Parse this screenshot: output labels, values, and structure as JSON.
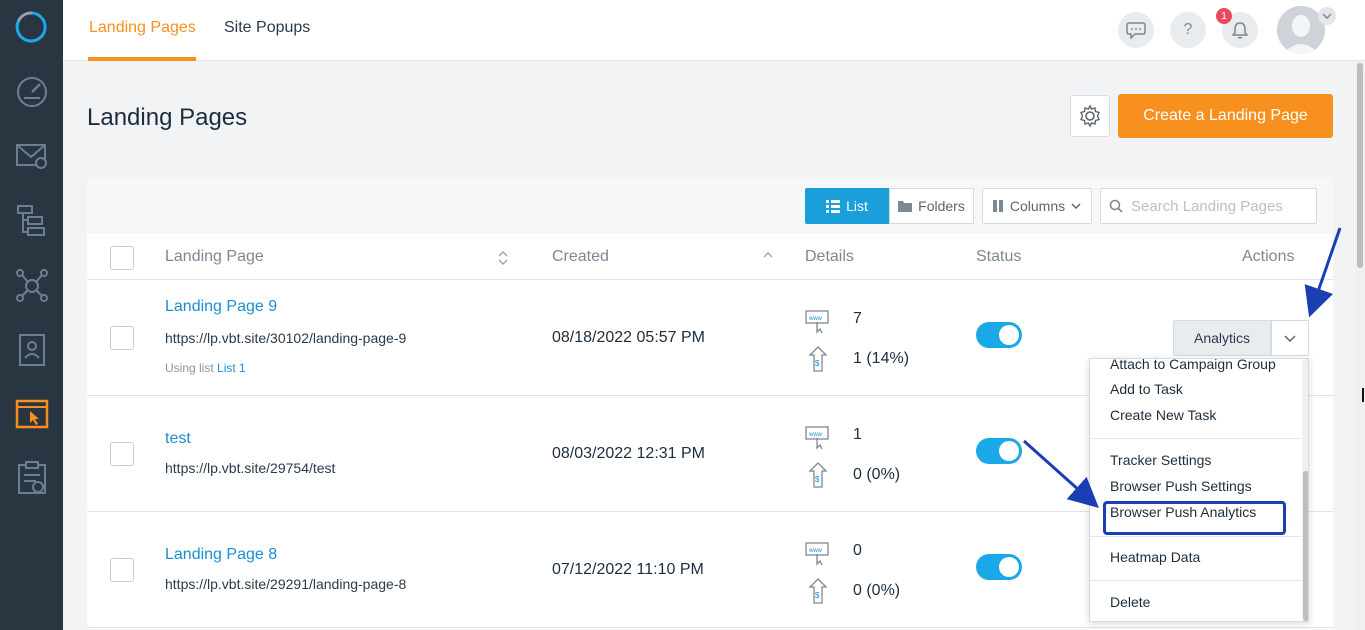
{
  "topbar": {
    "tabs": [
      {
        "label": "Landing Pages",
        "active": true
      },
      {
        "label": "Site Popups",
        "active": false
      }
    ],
    "notification_count": "1",
    "icons": [
      "chat-icon",
      "help-icon",
      "bell-icon",
      "avatar"
    ]
  },
  "sidebar": {
    "items": [
      "dashboard-icon",
      "email-icon",
      "workflow-icon",
      "network-icon",
      "contacts-icon",
      "landing-page-icon",
      "forms-icon"
    ],
    "active": "landing-page-icon"
  },
  "page": {
    "title": "Landing Pages",
    "create_button": "Create a Landing Page"
  },
  "toolbar": {
    "list_label": "List",
    "folders_label": "Folders",
    "columns_label": "Columns",
    "search_placeholder": "Search Landing Pages"
  },
  "table": {
    "headers": {
      "landing_page": "Landing Page",
      "created": "Created",
      "details": "Details",
      "status": "Status",
      "actions": "Actions"
    },
    "rows": [
      {
        "name": "Landing Page 9",
        "url": "https://lp.vbt.site/30102/landing-page-9",
        "using_list_prefix": "Using list",
        "using_list_name": "List 1",
        "created": "08/18/2022 05:57 PM",
        "visits": "7",
        "conversions": "1 (14%)",
        "status_on": true
      },
      {
        "name": "test",
        "url": "https://lp.vbt.site/29754/test",
        "created": "08/03/2022 12:31 PM",
        "visits": "1",
        "conversions": "0 (0%)",
        "status_on": true
      },
      {
        "name": "Landing Page 8",
        "url": "https://lp.vbt.site/29291/landing-page-8",
        "created": "07/12/2022 11:10 PM",
        "visits": "0",
        "conversions": "0 (0%)",
        "status_on": true
      }
    ],
    "analytics_button": "Analytics"
  },
  "dropdown": {
    "items": [
      "Attach to Campaign Group",
      "Add to Task",
      "Create New Task",
      "Tracker Settings",
      "Browser Push Settings",
      "Browser Push Analytics",
      "Heatmap Data",
      "Delete"
    ],
    "highlighted": "Browser Push Analytics"
  },
  "colors": {
    "accent": "#f7901e",
    "primary": "#1a9fdb",
    "sidebar": "#2a3542",
    "annotation": "#1a3fb3"
  }
}
